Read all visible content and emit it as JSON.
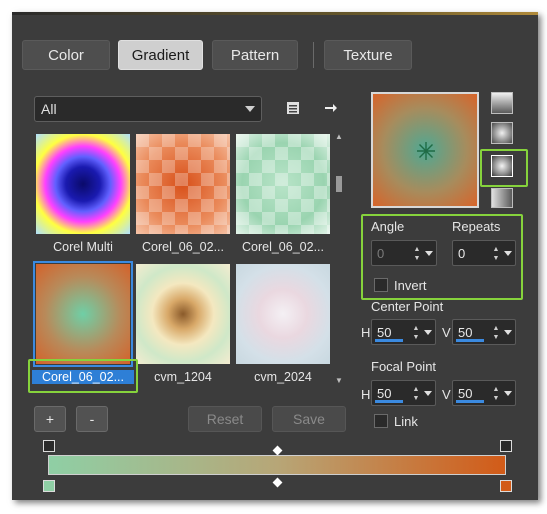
{
  "tabs": [
    "Color",
    "Gradient",
    "Pattern",
    "Texture"
  ],
  "category": {
    "value": "All"
  },
  "thumbnails": [
    {
      "label": "Corel Multi"
    },
    {
      "label": "Corel_06_02..."
    },
    {
      "label": "Corel_06_02..."
    },
    {
      "label": "Corel_06_02..."
    },
    {
      "label": "cvm_1204"
    },
    {
      "label": "cvm_2024"
    }
  ],
  "buttons": {
    "add": "+",
    "remove": "-",
    "reset": "Reset",
    "save": "Save"
  },
  "angle": {
    "label": "Angle",
    "value": "0"
  },
  "repeats": {
    "label": "Repeats",
    "value": "0"
  },
  "invert": {
    "label": "Invert",
    "checked": false
  },
  "center_point": {
    "label": "Center Point",
    "h_label": "H",
    "h_value": "50",
    "v_label": "V",
    "v_value": "50"
  },
  "focal_point": {
    "label": "Focal Point",
    "h_label": "H",
    "h_value": "50",
    "v_label": "V",
    "v_value": "50"
  },
  "link": {
    "label": "Link",
    "checked": false
  },
  "colors": {
    "accent": "#86d33c",
    "selection": "#2e7fd6",
    "gradient_start": "#8fcfa5",
    "gradient_end": "#d25b18"
  },
  "icons": [
    "gradient-menu-icon",
    "arrow-right-icon",
    "linear-type-icon",
    "rectangular-type-icon",
    "radial-type-icon",
    "conical-type-icon",
    "center-point-icon"
  ]
}
